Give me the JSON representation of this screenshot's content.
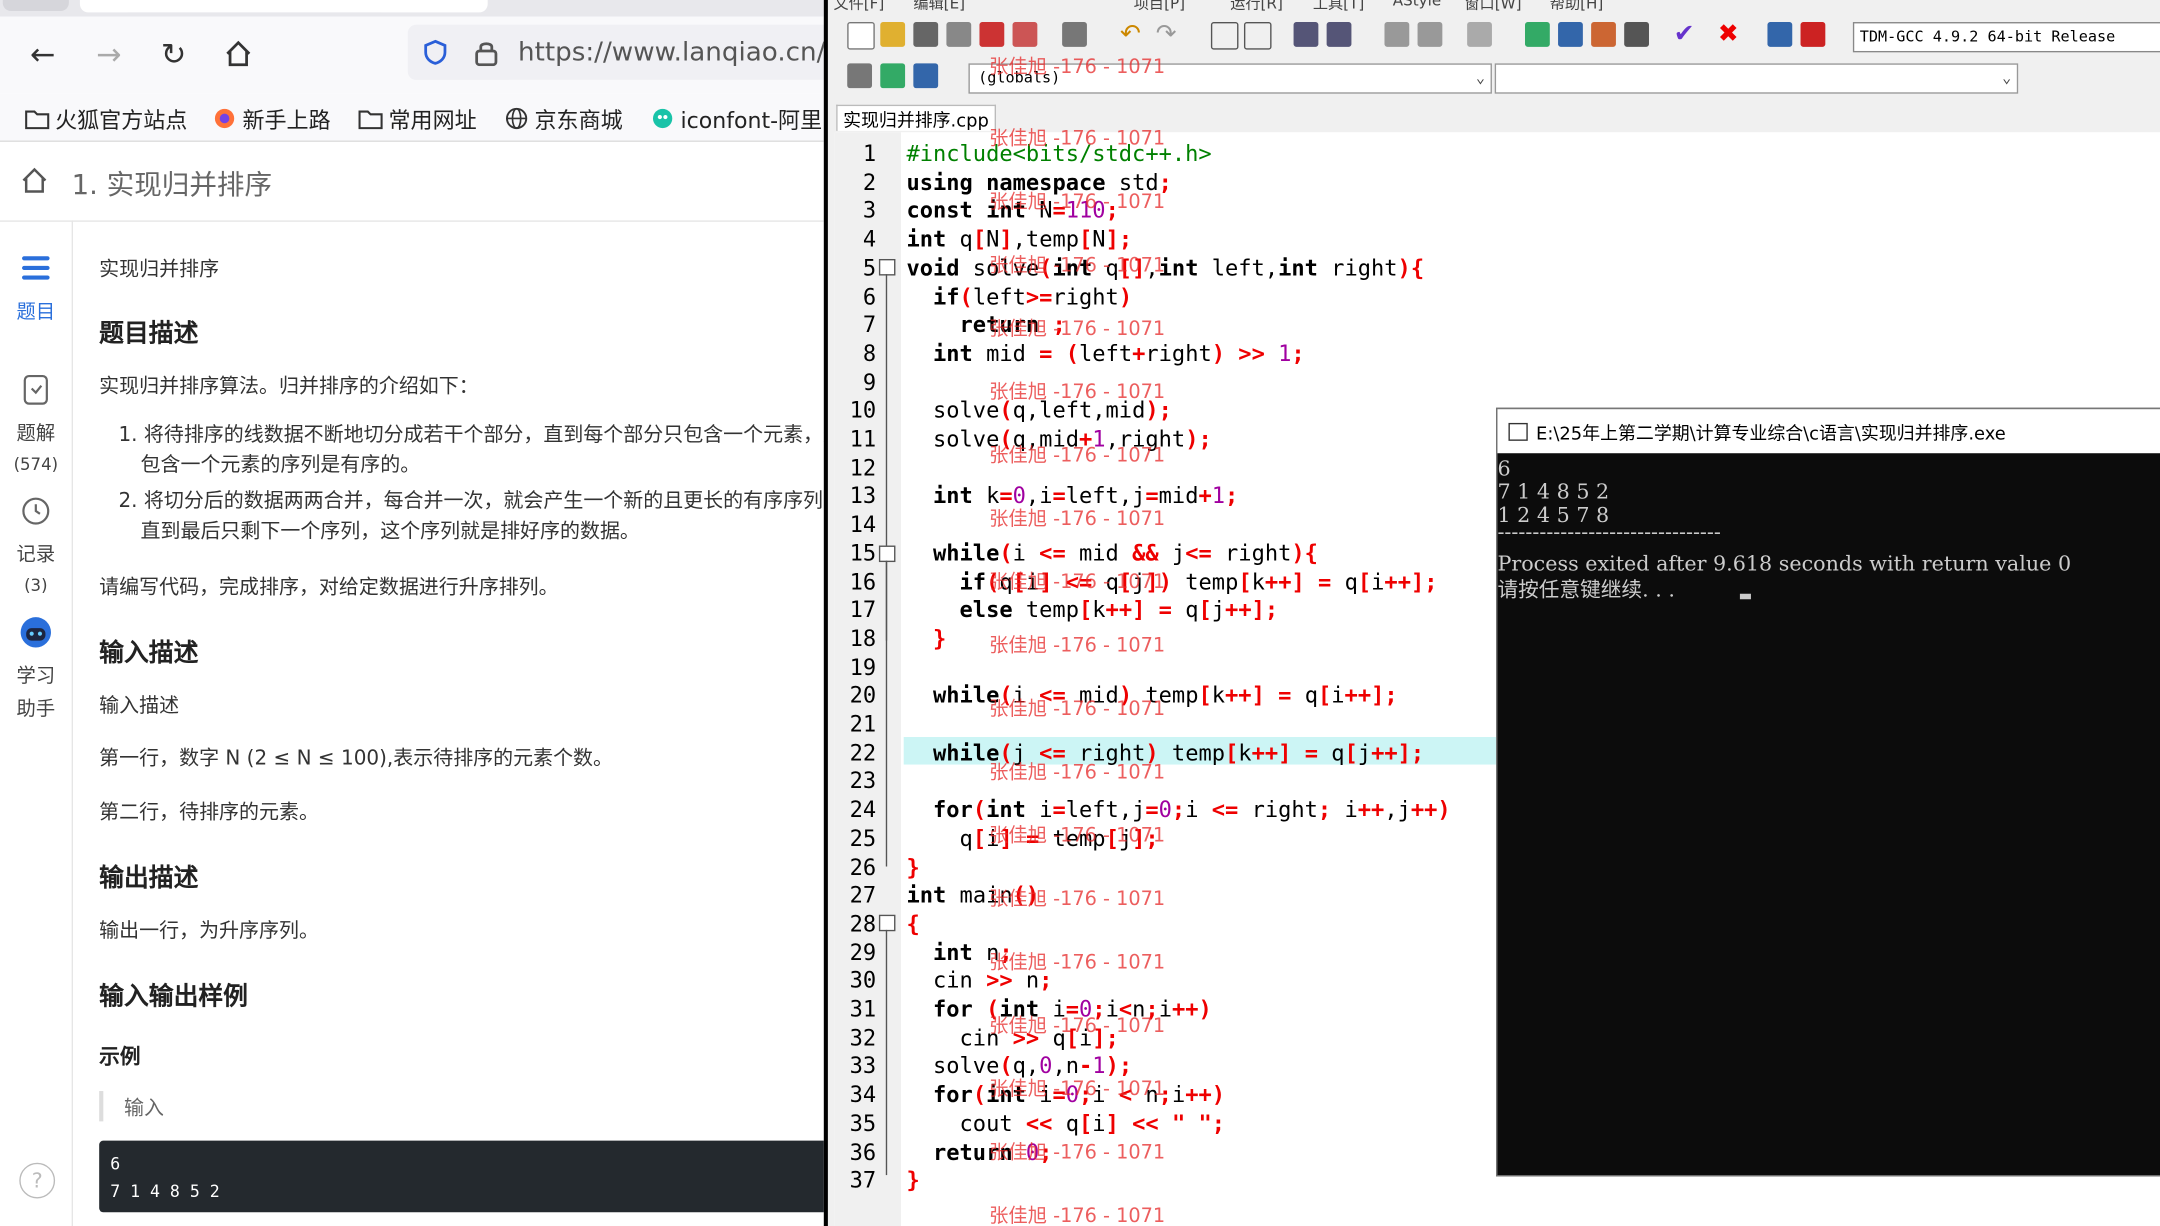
{
  "browser": {
    "url": "https://www.lanqiao.cn/p",
    "bookmarks": [
      "火狐官方站点",
      "新手上路",
      "常用网址",
      "京东商城",
      "iconfont-阿里"
    ],
    "breadcrumb_title": "1. 实现归并排序",
    "left_nav": [
      {
        "label": "题目",
        "count": ""
      },
      {
        "label": "题解",
        "count": "(574)"
      },
      {
        "label": "记录",
        "count": "(3)"
      },
      {
        "label": "学习",
        "count": "助手"
      }
    ],
    "problem": {
      "name": "实现归并排序",
      "desc_heading": "题目描述",
      "desc_intro": "实现归并排序算法。归并排序的介绍如下：",
      "list": [
        "1. 将待排序的线数据不断地切分成若干个部分，直到每个部分只包含一个元素，这",
        "包含一个元素的序列是有序的。",
        "2. 将切分后的数据两两合并，每合并一次，就会产生一个新的且更长的有序序列",
        "直到最后只剩下一个序列，这个序列就是排好序的数据。"
      ],
      "task": "请编写代码，完成排序，对给定数据进行升序排列。",
      "input_heading": "输入描述",
      "input_sub": "输入描述",
      "input_line1": "第一行，数字 N (2 ≤ N ≤ 100),表示待排序的元素个数。",
      "input_line2": "第二行，待排序的元素。",
      "output_heading": "输出描述",
      "output_line": "输出一行，为升序序列。",
      "io_heading": "输入输出样例",
      "example_label": "示例",
      "sample_input_label": "输入",
      "sample_input": [
        "6",
        "7 1 4 8 5 2"
      ]
    }
  },
  "ide": {
    "menu": [
      "文件[F]",
      "编辑[E]",
      "项目[P]",
      "运行[R]",
      "工具[T]",
      "AStyle",
      "窗口[W]",
      "帮助[H]"
    ],
    "compiler": "TDM-GCC 4.9.2 64-bit Release",
    "scope_combo": "(globals)",
    "file_tab": "实现归并排序.cpp",
    "watermark": "张佳旭 -176 - 1071",
    "lines": [
      "#include<bits/stdc++.h>",
      "using namespace std;",
      "const int N=110;",
      "int q[N],temp[N];",
      "void solve(int q[],int left,int right){",
      "  if(left>=right)",
      "    return ;",
      "  int mid = (left+right) >> 1;",
      "",
      "  solve(q,left,mid);",
      "  solve(q,mid+1,right);",
      "",
      "  int k=0,i=left,j=mid+1;",
      "",
      "  while(i <= mid && j<= right){",
      "    if(q[i] <= q[j]) temp[k++] = q[i++];",
      "    else temp[k++] = q[j++];",
      "  }",
      "",
      "  while(i <= mid) temp[k++] = q[i++];",
      "",
      "  while(j <= right) temp[k++] = q[j++];",
      "",
      "  for(int i=left,j=0;i <= right; i++,j++)",
      "    q[i] = temp[j];",
      "}",
      "int main()",
      "{",
      "  int n;",
      "  cin >> n;",
      "  for (int i=0;i<n;i++)",
      "    cin >> q[i];",
      "  solve(q,0,n-1);",
      "  for(int i=0;i < n;i++)",
      "    cout << q[i] << \" \";",
      "  return 0;",
      "}"
    ]
  },
  "console": {
    "title": "E:\\25年上第二学期\\计算专业综合\\c语言\\实现归并排序.exe",
    "lines": [
      "6",
      "7 1 4 8 5 2",
      "1 2 4 5 7 8",
      "--------------------------------",
      "Process exited after 9.618 seconds with return value 0",
      "请按任意键继续. . . "
    ]
  },
  "colors": {
    "keyword": "#000000",
    "operator": "#e00000",
    "number": "#a000a0",
    "highlight_line": "#ccf5f5",
    "console_bg": "#0c0c0c"
  }
}
